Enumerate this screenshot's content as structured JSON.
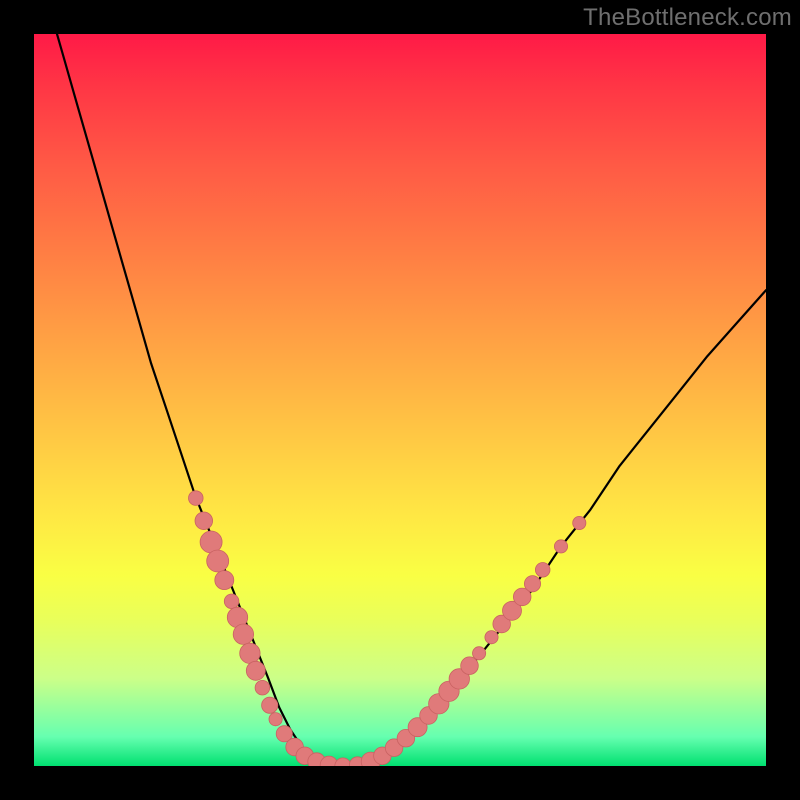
{
  "watermark": "TheBottleneck.com",
  "colors": {
    "page_bg": "#000000",
    "gradient_top": "#ff1a47",
    "gradient_bottom": "#00e070",
    "curve_stroke": "#000000",
    "bead_fill": "#e07a7a",
    "bead_stroke": "#c96262"
  },
  "chart_data": {
    "type": "line",
    "title": "",
    "xlabel": "",
    "ylabel": "",
    "xlim": [
      0,
      100
    ],
    "ylim": [
      0,
      100
    ],
    "grid": false,
    "legend": false,
    "note": "Axes unlabeled; values are relative percentages read from pixel positions within the plot area.",
    "series": [
      {
        "name": "curve",
        "x": [
          0,
          2,
          4,
          6,
          8,
          10,
          12,
          14,
          16,
          18,
          20,
          22,
          24,
          26,
          28,
          30,
          32,
          33.5,
          35,
          37,
          39,
          41,
          43,
          45,
          48,
          52,
          56,
          60,
          64,
          68,
          72,
          76,
          80,
          84,
          88,
          92,
          96,
          100
        ],
        "y": [
          111,
          104,
          97,
          90,
          83,
          76,
          69,
          62,
          55,
          49,
          43,
          37,
          32,
          27,
          22,
          17,
          12,
          8,
          5,
          2,
          0.5,
          0,
          0,
          0.5,
          2,
          5,
          9,
          14,
          19,
          24,
          30,
          35,
          41,
          46,
          51,
          56,
          60.5,
          65
        ]
      }
    ],
    "beads": {
      "name": "pink-beads",
      "points": [
        {
          "x": 22.1,
          "y": 36.6,
          "r": 1.0
        },
        {
          "x": 23.2,
          "y": 33.5,
          "r": 1.2
        },
        {
          "x": 24.2,
          "y": 30.6,
          "r": 1.5
        },
        {
          "x": 25.1,
          "y": 28.0,
          "r": 1.5
        },
        {
          "x": 26.0,
          "y": 25.4,
          "r": 1.3
        },
        {
          "x": 27.0,
          "y": 22.5,
          "r": 1.0
        },
        {
          "x": 27.8,
          "y": 20.3,
          "r": 1.4
        },
        {
          "x": 28.6,
          "y": 18.0,
          "r": 1.4
        },
        {
          "x": 29.5,
          "y": 15.4,
          "r": 1.4
        },
        {
          "x": 30.3,
          "y": 13.0,
          "r": 1.3
        },
        {
          "x": 31.2,
          "y": 10.7,
          "r": 1.0
        },
        {
          "x": 32.2,
          "y": 8.3,
          "r": 1.1
        },
        {
          "x": 33.0,
          "y": 6.4,
          "r": 0.9
        },
        {
          "x": 34.2,
          "y": 4.4,
          "r": 1.1
        },
        {
          "x": 35.6,
          "y": 2.6,
          "r": 1.2
        },
        {
          "x": 37.0,
          "y": 1.4,
          "r": 1.2
        },
        {
          "x": 38.6,
          "y": 0.6,
          "r": 1.2
        },
        {
          "x": 40.3,
          "y": 0.15,
          "r": 1.2
        },
        {
          "x": 42.2,
          "y": 0.0,
          "r": 1.1
        },
        {
          "x": 44.2,
          "y": 0.15,
          "r": 1.1
        },
        {
          "x": 46.0,
          "y": 0.6,
          "r": 1.3
        },
        {
          "x": 47.6,
          "y": 1.4,
          "r": 1.2
        },
        {
          "x": 49.2,
          "y": 2.5,
          "r": 1.2
        },
        {
          "x": 50.8,
          "y": 3.8,
          "r": 1.2
        },
        {
          "x": 52.4,
          "y": 5.3,
          "r": 1.3
        },
        {
          "x": 53.9,
          "y": 6.9,
          "r": 1.2
        },
        {
          "x": 55.3,
          "y": 8.5,
          "r": 1.4
        },
        {
          "x": 56.7,
          "y": 10.2,
          "r": 1.4
        },
        {
          "x": 58.1,
          "y": 11.9,
          "r": 1.4
        },
        {
          "x": 59.5,
          "y": 13.7,
          "r": 1.2
        },
        {
          "x": 60.8,
          "y": 15.4,
          "r": 0.9
        },
        {
          "x": 62.5,
          "y": 17.6,
          "r": 0.9
        },
        {
          "x": 63.9,
          "y": 19.4,
          "r": 1.2
        },
        {
          "x": 65.3,
          "y": 21.2,
          "r": 1.3
        },
        {
          "x": 66.7,
          "y": 23.1,
          "r": 1.2
        },
        {
          "x": 68.1,
          "y": 24.9,
          "r": 1.1
        },
        {
          "x": 69.5,
          "y": 26.8,
          "r": 1.0
        },
        {
          "x": 72.0,
          "y": 30.0,
          "r": 0.9
        },
        {
          "x": 74.5,
          "y": 33.2,
          "r": 0.9
        }
      ]
    }
  }
}
